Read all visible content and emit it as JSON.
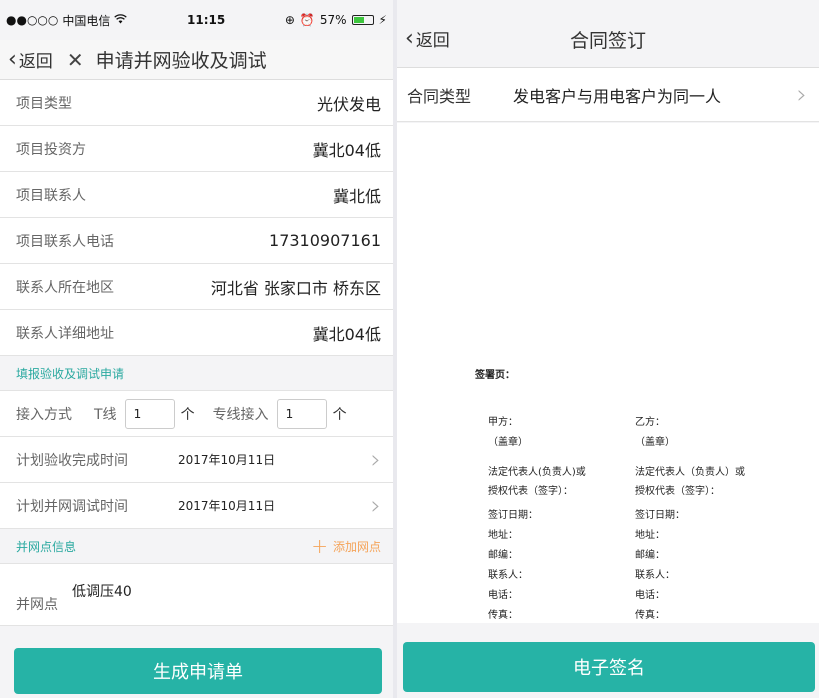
{
  "left_screen": {
    "status_bar": {
      "signal": "●●○○○",
      "carrier": "中国电信",
      "time": "11:15",
      "battery": "57%",
      "battery_level": 0.57
    },
    "nav": {
      "back_label": "返回",
      "title": "申请并网验收及调试"
    },
    "fields": [
      {
        "label": "项目类型",
        "value": "光伏发电"
      },
      {
        "label": "项目投资方",
        "value": "冀北04低"
      },
      {
        "label": "项目联系人",
        "value": "冀北低"
      },
      {
        "label": "项目联系人电话",
        "value": "17310907161"
      },
      {
        "label": "联系人所在地区",
        "value": "河北省 张家口市 桥东区"
      },
      {
        "label": "联系人详细地址",
        "value": "冀北04低"
      }
    ],
    "apply_section": {
      "title": "填报验收及调试申请"
    },
    "access": {
      "label": "接入方式",
      "t_line_label": "T线",
      "t_line_value": "1",
      "t_line_unit": "个",
      "dedicated_label": "专线接入",
      "dedicated_value": "1",
      "dedicated_unit": "个"
    },
    "schedule": [
      {
        "label": "计划验收完成时间",
        "value": "2017年10月11日"
      },
      {
        "label": "计划并网调试时间",
        "value": "2017年10月11日"
      }
    ],
    "grid_section": {
      "title": "并网点信息",
      "add_label": "添加网点"
    },
    "grid_point": {
      "label": "并网点",
      "value": "低调压40"
    },
    "submit_label": "生成申请单"
  },
  "right_screen": {
    "nav": {
      "back_label": "返回",
      "title": "合同签订"
    },
    "contract_type": {
      "label": "合同类型",
      "value": "发电客户与用电客户为同一人"
    },
    "document": {
      "signature_heading": "签署页：",
      "party_a": [
        "甲方：",
        "（盖章）",
        "法定代表人(负责人)或",
        "授权代表（签字）：",
        "签订日期：",
        "地址：",
        "邮编：",
        "联系人：",
        "电话：",
        "传真："
      ],
      "party_b": [
        "乙方：",
        "（盖章）",
        "法定代表人（负责人）或",
        "授权代表（签字）：",
        "签订日期：",
        "地址：",
        "邮编：",
        "联系人：",
        "电话：",
        "传真："
      ]
    },
    "sign_label": "电子签名"
  },
  "colors": {
    "accent": "#26b3a6",
    "section_text": "#2aa9a0",
    "add_orange": "#f5a45a"
  }
}
